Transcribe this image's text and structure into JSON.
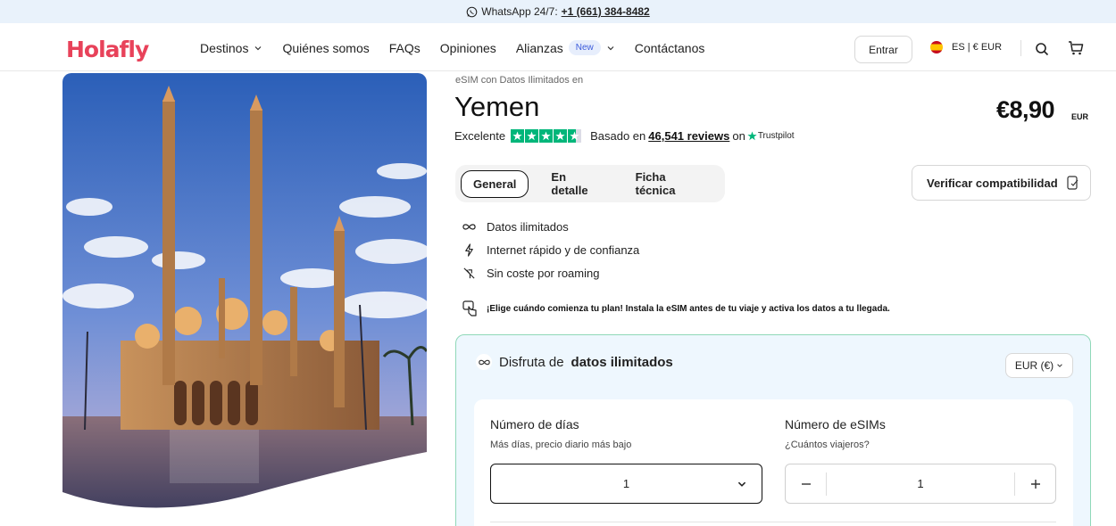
{
  "topbar": {
    "whatsapp_label": "WhatsApp 24/7:",
    "phone": "+1 (661) 384-8482"
  },
  "nav": {
    "logo": "Holafly",
    "items": [
      {
        "label": "Destinos",
        "has_dropdown": true
      },
      {
        "label": "Quiénes somos"
      },
      {
        "label": "FAQs"
      },
      {
        "label": "Opiniones"
      },
      {
        "label": "Alianzas",
        "badge": "New",
        "has_dropdown": true
      },
      {
        "label": "Contáctanos"
      }
    ],
    "login_label": "Entrar",
    "lang_currency": "ES | € EUR"
  },
  "product": {
    "subtitle": "eSIM con Datos Ilimitados en",
    "title": "Yemen",
    "price": "€8,90",
    "price_currency": "EUR",
    "rating_word": "Excelente",
    "rating_stars": 4.5,
    "reviews_prefix": "Basado en",
    "reviews_count": "46,541 reviews",
    "reviews_on": "on",
    "trustpilot": "Trustpilot"
  },
  "tabs": [
    {
      "label": "General",
      "active": true
    },
    {
      "label": "En detalle"
    },
    {
      "label": "Ficha técnica"
    }
  ],
  "verify_label": "Verificar compatibilidad",
  "features": [
    {
      "icon": "infinity-icon",
      "label": "Datos ilimitados"
    },
    {
      "icon": "lightning-icon",
      "label": "Internet rápido y de confianza"
    },
    {
      "icon": "no-roaming-icon",
      "label": "Sin coste por roaming"
    }
  ],
  "info_text": "¡Elige cuándo comienza tu plan! Instala la eSIM antes de tu viaje y activa los datos a tu llegada.",
  "plan": {
    "head_prefix": "Disfruta de",
    "head_bold": "datos ilimitados",
    "currency_select": "EUR (€)",
    "days_title": "Número de días",
    "days_sub": "Más días, precio diario más bajo",
    "days_value": "1",
    "esims_title": "Número de eSIMs",
    "esims_sub": "¿Cuántos viajeros?",
    "esims_value": "1"
  },
  "colors": {
    "brand": "#e8425a",
    "trustpilot_green": "#00b67a",
    "card_border": "#8fd8b8",
    "card_bg": "#eef7fe"
  }
}
